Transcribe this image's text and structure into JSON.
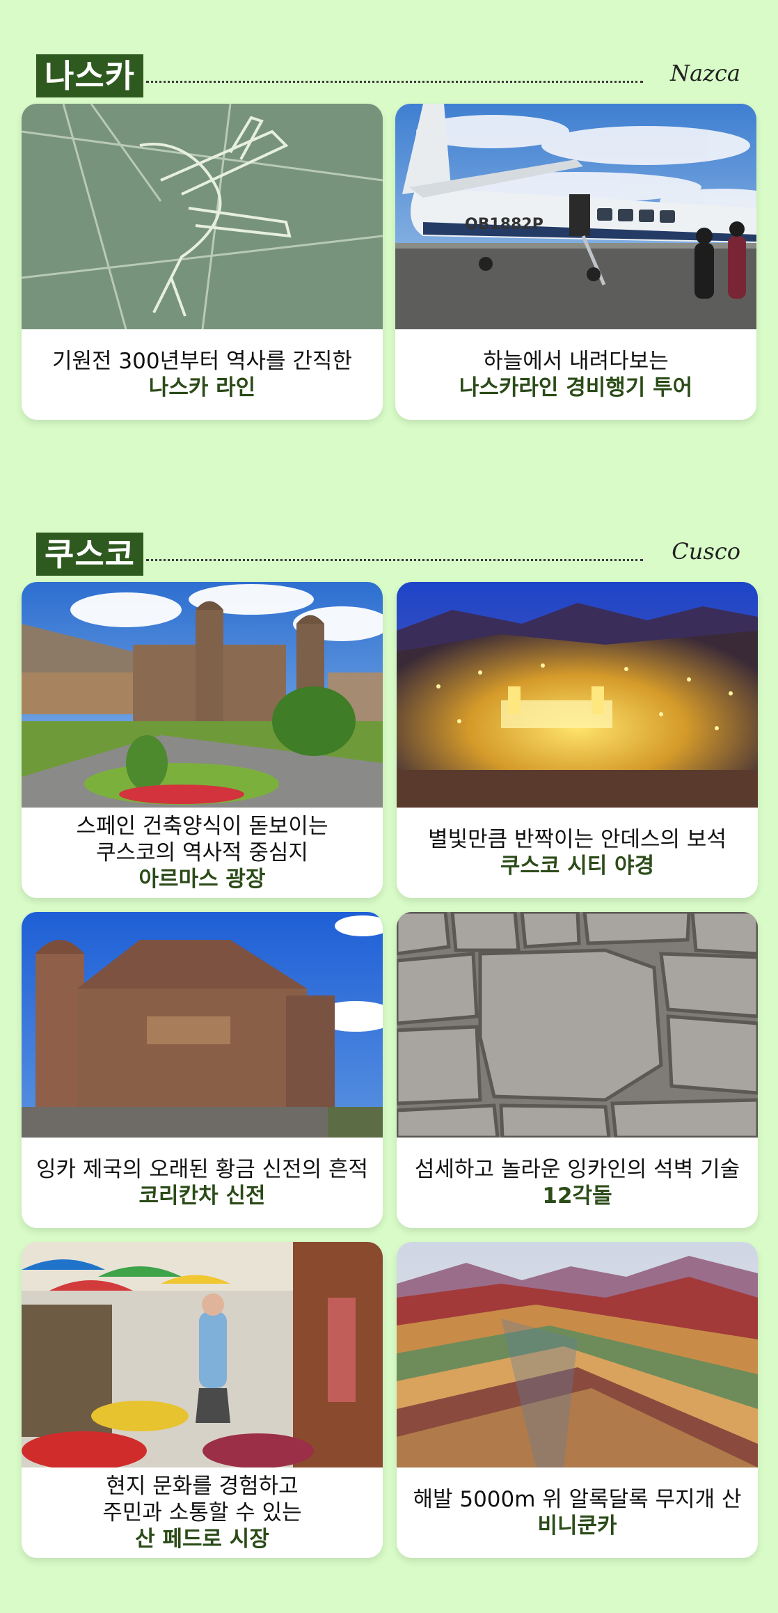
{
  "sections": [
    {
      "title": "나스카",
      "subtitle_en": "Nazca",
      "cards": [
        {
          "lines": [
            "기원전 300년부터 역사를 간직한"
          ],
          "highlight": "나스카 라인",
          "image": "nazca-lines-photo"
        },
        {
          "lines": [
            "하늘에서 내려다보는"
          ],
          "highlight": "나스카라인 경비행기 투어",
          "image": "cessna-airplane-photo",
          "plane_reg": "OB1882P"
        }
      ]
    },
    {
      "title": "쿠스코",
      "subtitle_en": "Cusco",
      "cards": [
        {
          "lines": [
            "스페인 건축양식이 돋보이는",
            "쿠스코의 역사적 중심지"
          ],
          "highlight": "아르마스 광장",
          "image": "plaza-de-armas-photo"
        },
        {
          "lines": [
            "별빛만큼 반짝이는 안데스의 보석"
          ],
          "highlight": "쿠스코 시티 야경",
          "image": "cusco-night-view-photo"
        },
        {
          "lines": [
            "잉카 제국의 오래된 황금 신전의 흔적"
          ],
          "highlight": "코리칸차 신전",
          "image": "qorikancha-temple-photo"
        },
        {
          "lines": [
            "섬세하고 놀라운 잉카인의 석벽 기술"
          ],
          "highlight": "12각돌",
          "image": "twelve-angled-stone-photo"
        },
        {
          "lines": [
            "현지 문화를 경험하고",
            "주민과 소통할 수 있는"
          ],
          "highlight": "산 페드로 시장",
          "image": "san-pedro-market-photo"
        },
        {
          "lines": [
            "해발 5000m 위 알록달록 무지개 산"
          ],
          "highlight": "비니쿤카",
          "image": "vinicunca-rainbow-mountain-photo"
        }
      ]
    }
  ],
  "colors": {
    "background": "#d8fbc7",
    "title_bg": "#2f5a1f",
    "highlight_text": "#2b4b18"
  }
}
